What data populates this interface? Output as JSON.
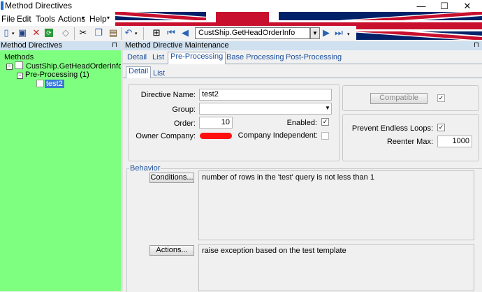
{
  "window": {
    "title": "Method Directives",
    "controls": [
      "—",
      "☐",
      "✕"
    ]
  },
  "menu": {
    "items": [
      "File",
      "Edit",
      "Tools",
      "Actions",
      "Help"
    ],
    "arrow": "▾"
  },
  "toolbar": {
    "icons": [
      "new-icon",
      "save-icon",
      "delete-icon",
      "refresh-icon",
      "clear-icon",
      "cut-icon",
      "copy-icon",
      "paste-icon",
      "undo-icon",
      "find-icon",
      "first-icon",
      "previous-icon",
      "next-icon",
      "last-icon"
    ],
    "nav_value": "CustShip.GetHeadOrderInfo"
  },
  "left_panel": {
    "header": "Method Directives",
    "pin": "⊓",
    "tree": {
      "root": "Methods",
      "method": "CustShip.GetHeadOrderInfo",
      "stage": "Pre-Processing (1)",
      "directive": "test2"
    }
  },
  "right_panel": {
    "header": "Method Directive Maintenance",
    "pin": "⊓",
    "tabs": [
      "Detail",
      "List",
      "Pre-Processing",
      "Base Processing",
      "Post-Processing"
    ],
    "subtabs": [
      "Detail",
      "List"
    ],
    "form": {
      "directive_name_label": "Directive Name:",
      "directive_name_value": "test2",
      "group_label": "Group:",
      "group_value": "",
      "order_label": "Order:",
      "order_value": "10",
      "enabled_label": "Enabled:",
      "enabled_checked": true,
      "owner_company_label": "Owner Company:",
      "company_independent_label": "Company Independent:",
      "company_independent_checked": false,
      "compatible_label": "Compatible",
      "compatible_checked": true,
      "prevent_loops_label": "Prevent Endless Loops:",
      "prevent_loops_checked": true,
      "reenter_max_label": "Reenter Max:",
      "reenter_max_value": "1000"
    },
    "behavior": {
      "title": "Behavior",
      "conditions_button": "Conditions...",
      "conditions_text": "number of rows in the 'test' query is not less than 1",
      "actions_button": "Actions...",
      "actions_text": "raise exception based on the test template"
    }
  },
  "colors": {
    "left_bg": "#7fff7f",
    "header_bg": "#cfe0ef",
    "selection": "#3a78d8",
    "redaction": "#ff1010"
  }
}
